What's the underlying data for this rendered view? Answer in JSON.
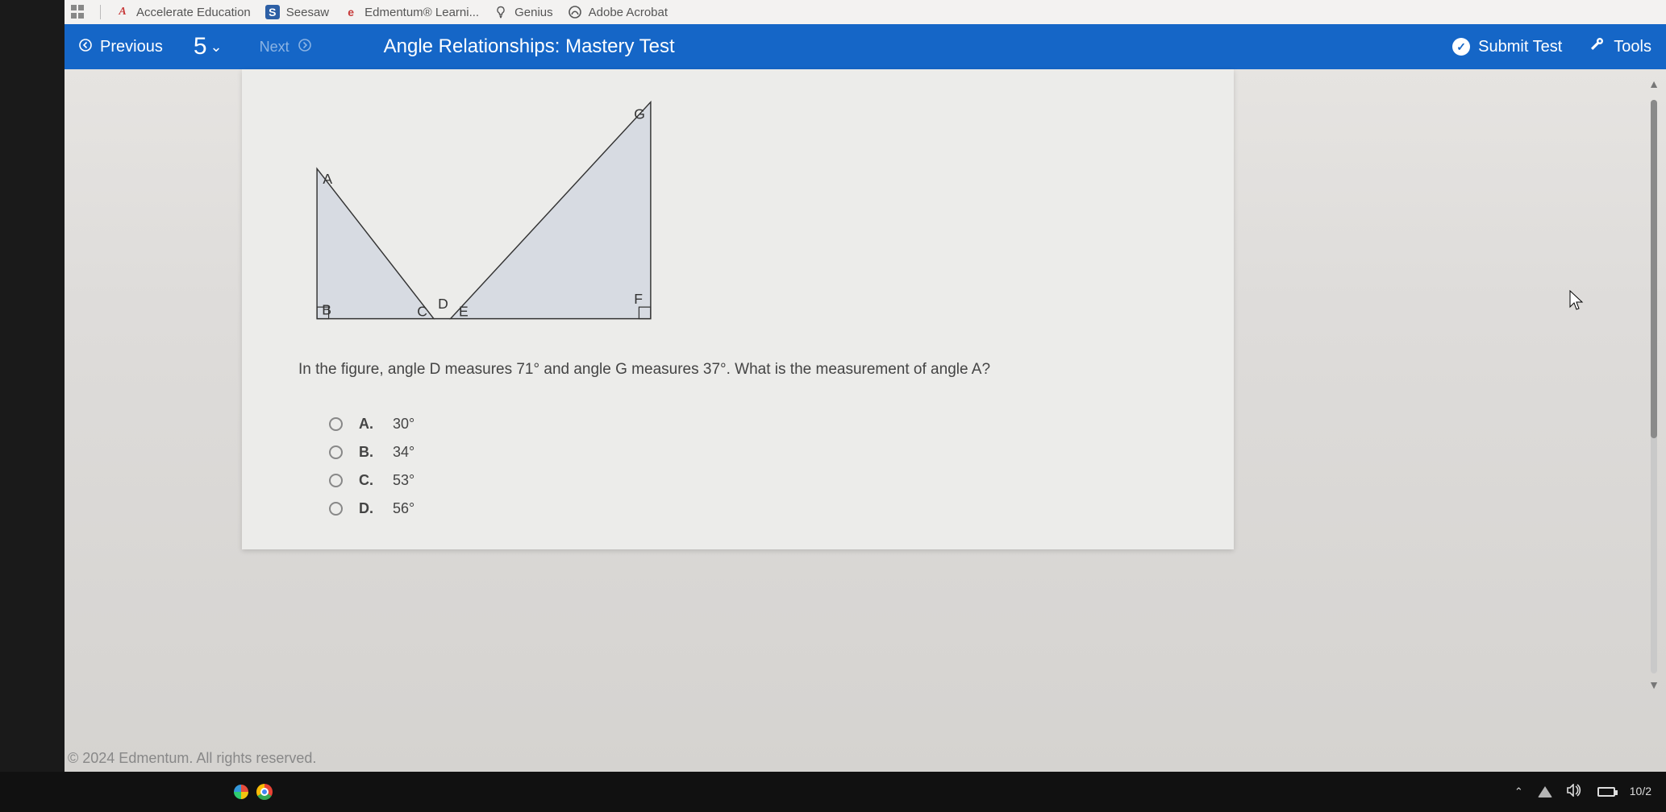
{
  "tabs": {
    "t1": "Accelerate Education",
    "t2": "Seesaw",
    "t3": "Edmentum® Learni...",
    "t4": "Genius",
    "t5": "Adobe Acrobat"
  },
  "toolbar": {
    "previous": "Previous",
    "question_num": "5",
    "next": "Next",
    "title": "Angle Relationships: Mastery Test",
    "submit": "Submit Test",
    "tools": "Tools"
  },
  "figure": {
    "labels": {
      "A": "A",
      "B": "B",
      "C": "C",
      "D": "D",
      "E": "E",
      "F": "F",
      "G": "G"
    }
  },
  "question": "In the figure, angle D measures 71° and angle G measures 37°. What is the measurement of angle A?",
  "options": [
    {
      "letter": "A.",
      "text": "30°"
    },
    {
      "letter": "B.",
      "text": "34°"
    },
    {
      "letter": "C.",
      "text": "53°"
    },
    {
      "letter": "D.",
      "text": "56°"
    }
  ],
  "copyright": "© 2024 Edmentum. All rights reserved.",
  "taskbar": {
    "date": "10/2"
  }
}
